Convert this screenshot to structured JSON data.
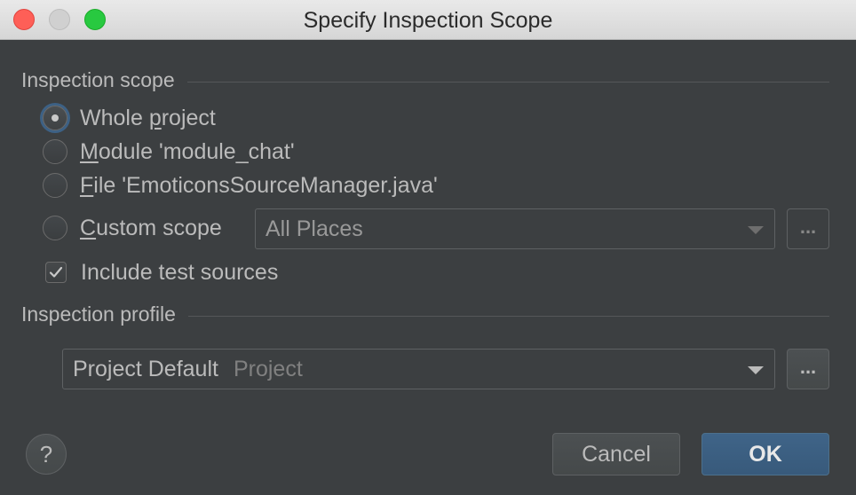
{
  "window": {
    "title": "Specify Inspection Scope"
  },
  "scope": {
    "header": "Inspection scope",
    "options": [
      {
        "pre": "Whole ",
        "mnemonic": "p",
        "post": "roject",
        "selected": true
      },
      {
        "pre": "",
        "mnemonic": "M",
        "post": "odule 'module_chat'",
        "selected": false
      },
      {
        "pre": "",
        "mnemonic": "F",
        "post": "ile 'EmoticonsSourceManager.java'",
        "selected": false
      },
      {
        "pre": "",
        "mnemonic": "C",
        "post": "ustom scope",
        "selected": false
      }
    ],
    "custom_scope_value": "All Places",
    "custom_scope_more": "...",
    "include_tests_label": "Include test sources",
    "include_tests_checked": true
  },
  "profile": {
    "header": "Inspection profile",
    "name": "Project Default",
    "kind": "Project",
    "more": "..."
  },
  "buttons": {
    "help": "?",
    "cancel": "Cancel",
    "ok": "OK"
  }
}
